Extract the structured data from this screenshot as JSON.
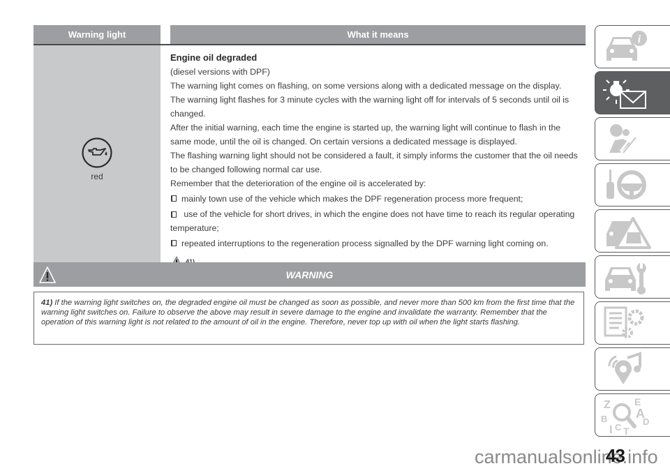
{
  "table": {
    "headers": {
      "left": "Warning light",
      "right": "What it means"
    },
    "row": {
      "icon": "engine-oil-icon",
      "color_label": "red",
      "title": "Engine oil degraded",
      "paragraphs": [
        "(diesel versions with DPF)",
        "The warning light comes on flashing, on some versions along with a dedicated message on the display.",
        "The warning light flashes for 3 minute cycles with the warning light off for intervals of 5 seconds until oil is changed.",
        "After the initial warning, each time the engine is started up, the warning light will continue to flash in the same mode, until the oil is changed. On certain versions a dedicated message is displayed.",
        "The flashing warning light should not be considered a fault, it simply informs the customer that the oil needs to be changed following normal car use.",
        "Remember that the deterioration of the engine oil is accelerated by:"
      ],
      "bullets": [
        "mainly town use of the vehicle which makes the DPF regeneration process more frequent;",
        "use of the vehicle for short drives, in which the engine does not have time to reach its regular operating temperature;",
        "repeated interruptions to the regeneration process signalled by the DPF warning light coming on."
      ],
      "ref": "41)"
    }
  },
  "warning": {
    "title": "WARNING",
    "ref": "41)",
    "text": "If the warning light switches on, the degraded engine oil must be changed as soon as possible, and never more than 500 km from the first time that the warning light switches on. Failure to observe the above may result in severe damage to the engine and invalidate the warranty. Remember that the operation of this warning light is not related to the amount of oil in the engine. Therefore, never top up with oil when the light starts flashing."
  },
  "sidebar": {
    "tabs": [
      {
        "name": "car-info",
        "active": false
      },
      {
        "name": "warning-lights-messages",
        "active": true
      },
      {
        "name": "safety",
        "active": false
      },
      {
        "name": "starting-driving",
        "active": false
      },
      {
        "name": "emergency",
        "active": false
      },
      {
        "name": "maintenance",
        "active": false
      },
      {
        "name": "technical-data",
        "active": false
      },
      {
        "name": "multimedia",
        "active": false
      },
      {
        "name": "index",
        "active": false
      }
    ],
    "index_letters": [
      "Z",
      "E",
      "A",
      "B",
      "D",
      "I",
      "C",
      "T"
    ]
  },
  "page_number": "43",
  "watermark": "carmanualsonline.info",
  "colors": {
    "header_gray": "#9c9ea1",
    "cell_gray": "#c8c9ca",
    "active_tab": "#5e5f61",
    "icon_gray": "#c8c8c8"
  }
}
